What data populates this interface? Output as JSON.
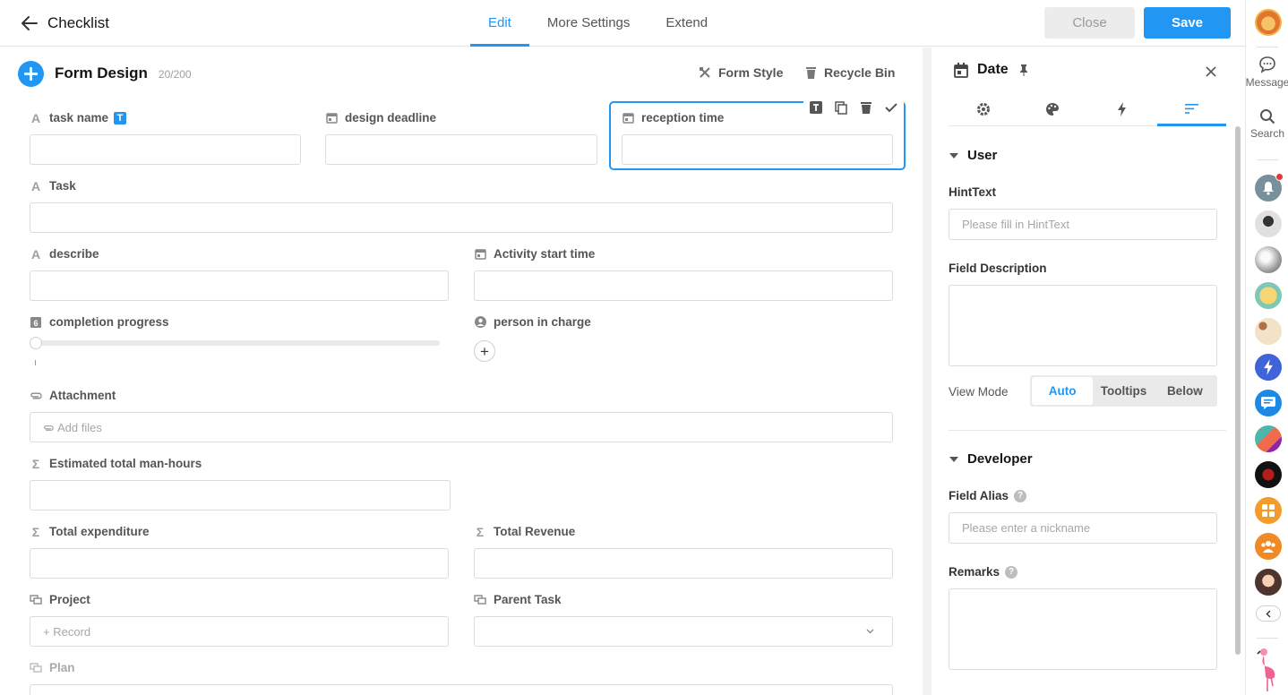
{
  "header": {
    "title": "Checklist",
    "tabs": [
      {
        "label": "Edit",
        "active": true
      },
      {
        "label": "More Settings",
        "active": false
      },
      {
        "label": "Extend",
        "active": false
      }
    ],
    "close_label": "Close",
    "save_label": "Save"
  },
  "form_design": {
    "title": "Form Design",
    "count": "20/200",
    "form_style_label": "Form Style",
    "recycle_bin_label": "Recycle Bin",
    "fields": {
      "task_name": {
        "label": "task name",
        "badge": "T"
      },
      "design_deadline": {
        "label": "design deadline"
      },
      "reception_time": {
        "label": "reception time"
      },
      "task": {
        "label": "Task"
      },
      "describe": {
        "label": "describe"
      },
      "activity_start_time": {
        "label": "Activity start time"
      },
      "completion_progress": {
        "label": "completion progress",
        "value": 0
      },
      "person_in_charge": {
        "label": "person in charge",
        "add_symbol": "+"
      },
      "attachment": {
        "label": "Attachment",
        "placeholder": "Add files"
      },
      "estimated_total_man_hours": {
        "label": "Estimated total man-hours"
      },
      "total_expenditure": {
        "label": "Total expenditure"
      },
      "total_revenue": {
        "label": "Total Revenue"
      },
      "project": {
        "label": "Project",
        "placeholder": "+ Record"
      },
      "parent_task": {
        "label": "Parent Task"
      },
      "plan": {
        "label": "Plan"
      }
    }
  },
  "right_panel": {
    "title": "Date",
    "tabs": [
      "settings-icon",
      "palette-icon",
      "bolt-icon",
      "sort-icon"
    ],
    "active_tab": 3,
    "user_section": {
      "title": "User",
      "hint_text_label": "HintText",
      "hint_text_placeholder": "Please fill in HintText",
      "field_description_label": "Field Description",
      "view_mode_label": "View Mode",
      "view_mode_options": [
        "Auto",
        "Tooltips",
        "Below"
      ],
      "view_mode_selected": "Auto"
    },
    "developer_section": {
      "title": "Developer",
      "field_alias_label": "Field Alias",
      "field_alias_placeholder": "Please enter a nickname",
      "remarks_label": "Remarks",
      "help_symbol": "?"
    }
  },
  "side_rail": {
    "message_label": "Message",
    "search_label": "Search"
  },
  "colors": {
    "accent": "#2196f3",
    "notification_dot": "#e53935"
  }
}
